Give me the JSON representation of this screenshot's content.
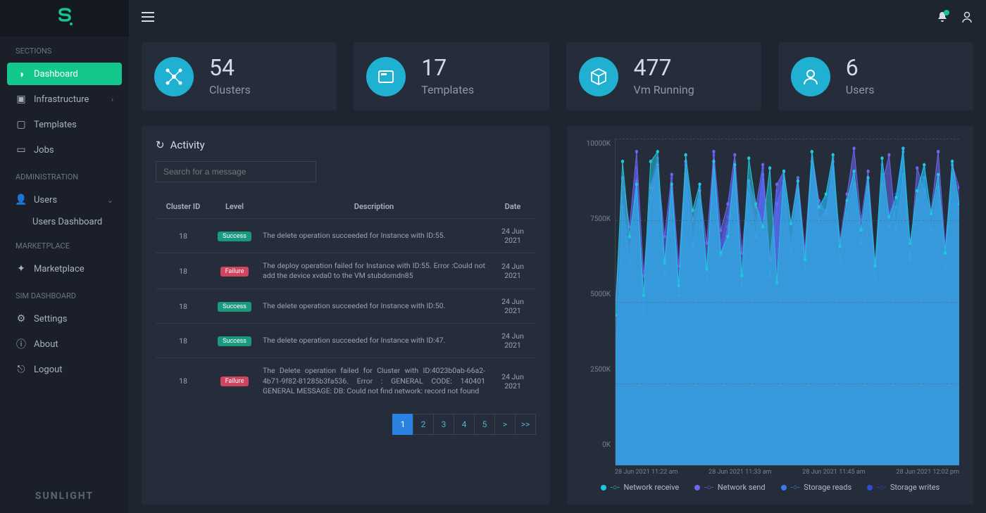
{
  "brand_footer": "SUNLIGHT",
  "sidebar": {
    "sections_label": "SECTIONS",
    "dashboard": "Dashboard",
    "infrastructure": "Infrastructure",
    "templates": "Templates",
    "jobs": "Jobs",
    "admin_label": "ADMINISTRATION",
    "users": "Users",
    "users_dashboard": "Users Dashboard",
    "marketplace_label": "MARKETPLACE",
    "marketplace": "Marketplace",
    "sim_label": "SIM DASHBOARD",
    "settings": "Settings",
    "about": "About",
    "logout": "Logout"
  },
  "stats": {
    "clusters_num": "54",
    "clusters_lbl": "Clusters",
    "templates_num": "17",
    "templates_lbl": "Templates",
    "vm_num": "477",
    "vm_lbl": "Vm Running",
    "users_num": "6",
    "users_lbl": "Users"
  },
  "activity": {
    "title": "Activity",
    "search_placeholder": "Search for a message",
    "col_cluster": "Cluster ID",
    "col_level": "Level",
    "col_desc": "Description",
    "col_date": "Date",
    "rows": [
      {
        "cid": "18",
        "level": "Success",
        "level_class": "success",
        "desc": "The delete operation succeeded for Instance with ID:55.",
        "date": "24 Jun 2021"
      },
      {
        "cid": "18",
        "level": "Failure",
        "level_class": "failure",
        "desc": "The deploy operation failed for Instance with ID:55. Error :Could not add the device xvda0 to the VM stubdomdn85",
        "date": "24 Jun 2021"
      },
      {
        "cid": "18",
        "level": "Success",
        "level_class": "success",
        "desc": "The delete operation succeeded for Instance with ID:50.",
        "date": "24 Jun 2021"
      },
      {
        "cid": "18",
        "level": "Success",
        "level_class": "success",
        "desc": "The delete operation succeeded for Instance with ID:47.",
        "date": "24 Jun 2021"
      },
      {
        "cid": "18",
        "level": "Failure",
        "level_class": "failure",
        "desc": "The Delete operation failed for Cluster with ID:4023b0ab-66a2-4b71-9f82-81285b3fa536. Error : GENERAL CODE: 140401 GENERAL MESSAGE: DB: Could not find network: record not found",
        "date": "24 Jun 2021"
      }
    ],
    "pages": [
      "1",
      "2",
      "3",
      "4",
      "5",
      ">",
      ">>"
    ]
  },
  "chart_data": {
    "type": "area",
    "ylabel": "",
    "ylim": [
      0,
      10000
    ],
    "y_ticks": [
      "10000K",
      "7500K",
      "5000K",
      "2500K",
      "0K"
    ],
    "x_ticks": [
      "28 Jun 2021 11:22 am",
      "28 Jun 2021 11:33 am",
      "28 Jun 2021 11:45 am",
      "28 Jun 2021 12:02 pm"
    ],
    "series": [
      {
        "name": "Network receive",
        "color": "#20c6d9",
        "values": [
          4600,
          9300,
          7000,
          8600,
          5200,
          9300,
          9600,
          6200,
          8600,
          5500,
          9500,
          7800,
          8600,
          6000,
          9300,
          6500,
          7000,
          9200,
          5800,
          9400,
          8000,
          7300,
          9100,
          5600,
          9000,
          7400,
          8700,
          6300,
          9600,
          7900,
          8300,
          9500,
          6700,
          8100,
          9000,
          7200,
          8800,
          6100,
          9400,
          7600,
          8200,
          9700,
          6800,
          8400,
          9200,
          7700,
          8900,
          6500,
          9300,
          8000
        ]
      },
      {
        "name": "Network send",
        "color": "#6b66f0",
        "values": [
          5000,
          8800,
          7300,
          9600,
          5800,
          8500,
          9200,
          7000,
          8900,
          6100,
          9300,
          7500,
          8400,
          6800,
          9600,
          7200,
          8000,
          9500,
          6500,
          8700,
          7900,
          9200,
          6300,
          8600,
          9000,
          7400,
          8800,
          6600,
          9600,
          8100,
          7700,
          9300,
          6900,
          8300,
          9700,
          7500,
          9000,
          6200,
          8600,
          9500,
          7200,
          8900,
          6400,
          9100,
          8400,
          7800,
          9600,
          6700,
          9200,
          8500
        ]
      },
      {
        "name": "Storage reads",
        "color": "#3a7af0",
        "values": [
          3000,
          7900,
          6200,
          8700,
          4600,
          8200,
          9100,
          5900,
          8500,
          5200,
          8900,
          6700,
          8100,
          5700,
          9200,
          6400,
          7300,
          9100,
          5500,
          8300,
          7000,
          8900,
          5800,
          8000,
          8700,
          6500,
          8400,
          6000,
          9300,
          7500,
          7800,
          9100,
          6300,
          7700,
          8600,
          6800,
          8500,
          5700,
          8900,
          7300,
          7900,
          9600,
          6300,
          8100,
          8800,
          7200,
          8500,
          6000,
          8900,
          7700
        ]
      },
      {
        "name": "Storage writes",
        "color": "#2a4cd8",
        "values": [
          3400,
          8200,
          6600,
          9100,
          5000,
          8600,
          9400,
          6300,
          8800,
          5600,
          9200,
          7100,
          8500,
          6100,
          9500,
          6800,
          7600,
          9300,
          5900,
          8600,
          7400,
          9100,
          6100,
          8400,
          9000,
          6900,
          8700,
          6400,
          9600,
          7900,
          8200,
          9400,
          6700,
          8000,
          8900,
          7200,
          8800,
          6100,
          9200,
          7700,
          8300,
          9700,
          6700,
          8400,
          9100,
          7600,
          8800,
          6400,
          9300,
          8000
        ]
      }
    ],
    "legend": {
      "network_receive": "Network receive",
      "network_send": "Network send",
      "storage_reads": "Storage reads",
      "storage_writes": "Storage writes"
    }
  }
}
